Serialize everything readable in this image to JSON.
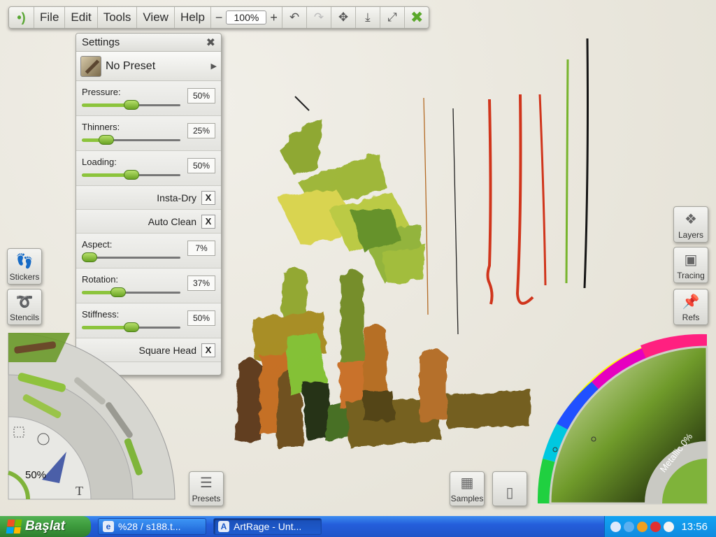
{
  "menubar": {
    "items": [
      "File",
      "Edit",
      "Tools",
      "View",
      "Help"
    ],
    "zoom_minus": "−",
    "zoom_value": "100%",
    "zoom_plus": "+",
    "close_label": "✖"
  },
  "settings": {
    "title": "Settings",
    "close": "✖",
    "preset": "No Preset",
    "sliders": [
      {
        "label": "Pressure:",
        "value": "50%",
        "level": 0.5
      },
      {
        "label": "Thinners:",
        "value": "25%",
        "level": 0.25
      },
      {
        "label": "Loading:",
        "value": "50%",
        "level": 0.5
      },
      {
        "label": "Aspect:",
        "value": "7%",
        "level": 0.07
      },
      {
        "label": "Rotation:",
        "value": "37%",
        "level": 0.37
      },
      {
        "label": "Stiffness:",
        "value": "50%",
        "level": 0.5
      }
    ],
    "toggles": [
      {
        "label": "Insta-Dry",
        "mark": "X"
      },
      {
        "label": "Auto Clean",
        "mark": "X"
      },
      {
        "label": "Square Head",
        "mark": "X"
      }
    ]
  },
  "left_buttons": [
    "Stickers",
    "Stencils"
  ],
  "tool_size": "50%",
  "presets_label": "Presets",
  "right_buttons": [
    "Layers",
    "Tracing",
    "Refs"
  ],
  "bottom_buttons": [
    "Samples"
  ],
  "color_picker": {
    "metallic_label": "Metallic 0%",
    "accent": "#7fb33a"
  },
  "taskbar": {
    "start_label": "Başlat",
    "tasks": [
      "%28 / s188.t...",
      "ArtRage - Unt..."
    ],
    "clock": "13:56"
  }
}
